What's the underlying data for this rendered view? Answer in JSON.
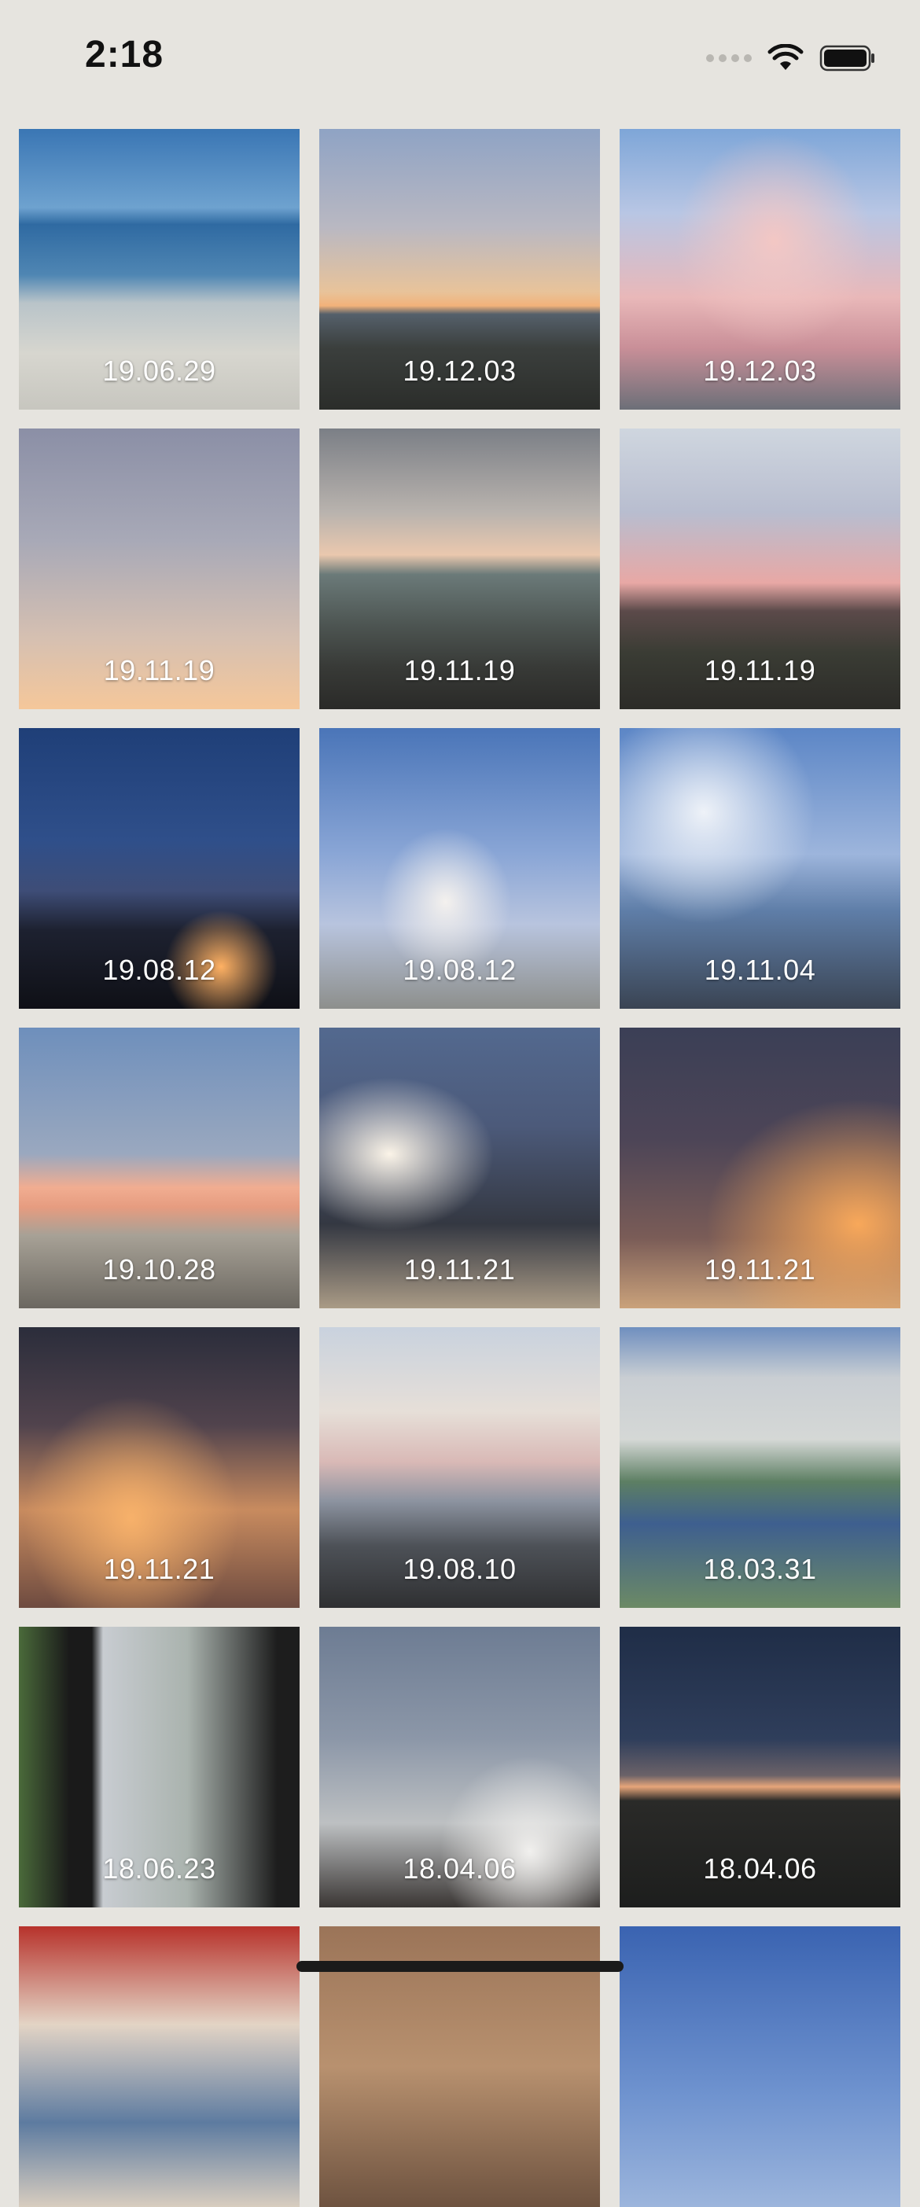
{
  "status_bar": {
    "time": "2:18",
    "icons": [
      "cellular-signal-icon",
      "wifi-icon",
      "battery-icon"
    ]
  },
  "photos": [
    {
      "date": "19.06.29",
      "scene": "sea-bridge"
    },
    {
      "date": "19.12.03",
      "scene": "sunset-road"
    },
    {
      "date": "19.12.03",
      "scene": "pink-clouds"
    },
    {
      "date": "19.11.19",
      "scene": "twilight-gradient"
    },
    {
      "date": "19.11.19",
      "scene": "rocky-coast"
    },
    {
      "date": "19.11.19",
      "scene": "street-dusk"
    },
    {
      "date": "19.08.12",
      "scene": "night-city"
    },
    {
      "date": "19.08.12",
      "scene": "blue-sky-cloud"
    },
    {
      "date": "19.11.04",
      "scene": "cloud-building"
    },
    {
      "date": "19.10.28",
      "scene": "orange-cloud-band"
    },
    {
      "date": "19.11.21",
      "scene": "dramatic-cloud"
    },
    {
      "date": "19.11.21",
      "scene": "orange-cumulus"
    },
    {
      "date": "19.11.21",
      "scene": "sunset-cumulus"
    },
    {
      "date": "19.08.10",
      "scene": "coast-clouds"
    },
    {
      "date": "18.03.31",
      "scene": "tennis-court"
    },
    {
      "date": "18.06.23",
      "scene": "window-street"
    },
    {
      "date": "18.04.06",
      "scene": "tree-sky"
    },
    {
      "date": "18.04.06",
      "scene": "dusk-horizon"
    },
    {
      "date": "",
      "scene": "shop-street"
    },
    {
      "date": "",
      "scene": "indoor"
    },
    {
      "date": "",
      "scene": "blue-sky"
    }
  ],
  "colors": {
    "background": "#e6e4df",
    "date_text": "#ffffff"
  }
}
